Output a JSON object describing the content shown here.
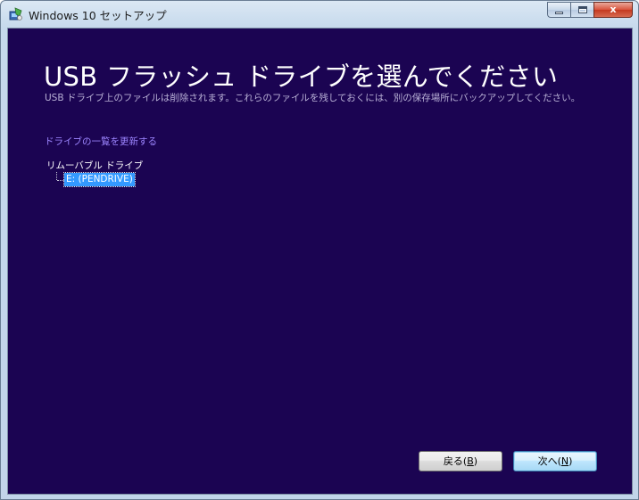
{
  "window": {
    "title": "Windows 10 セットアップ",
    "icon": "setup-app-icon",
    "caption_buttons": [
      "minimize",
      "maximize",
      "close"
    ],
    "close_glyph": "x"
  },
  "page": {
    "heading": "USB フラッシュ ドライブを選んでください",
    "subtext": "USB ドライブ上のファイルは削除されます。これらのファイルを残しておくには、別の保存場所にバックアップしてください。",
    "refresh_link": "ドライブの一覧を更新する"
  },
  "drive_tree": {
    "root_label": "リムーバブル ドライブ",
    "items": [
      {
        "label": "E: (PENDRIVE)",
        "selected": true
      }
    ]
  },
  "buttons": {
    "back": {
      "label": "戻る",
      "accel_open": "(",
      "accel_key": "B",
      "accel_close": ")"
    },
    "next": {
      "label": "次へ",
      "accel_open": "(",
      "accel_key": "N",
      "accel_close": ")"
    }
  },
  "colors": {
    "background": "#1b0452",
    "link": "#9d86ff",
    "selection": "#3399ff"
  }
}
